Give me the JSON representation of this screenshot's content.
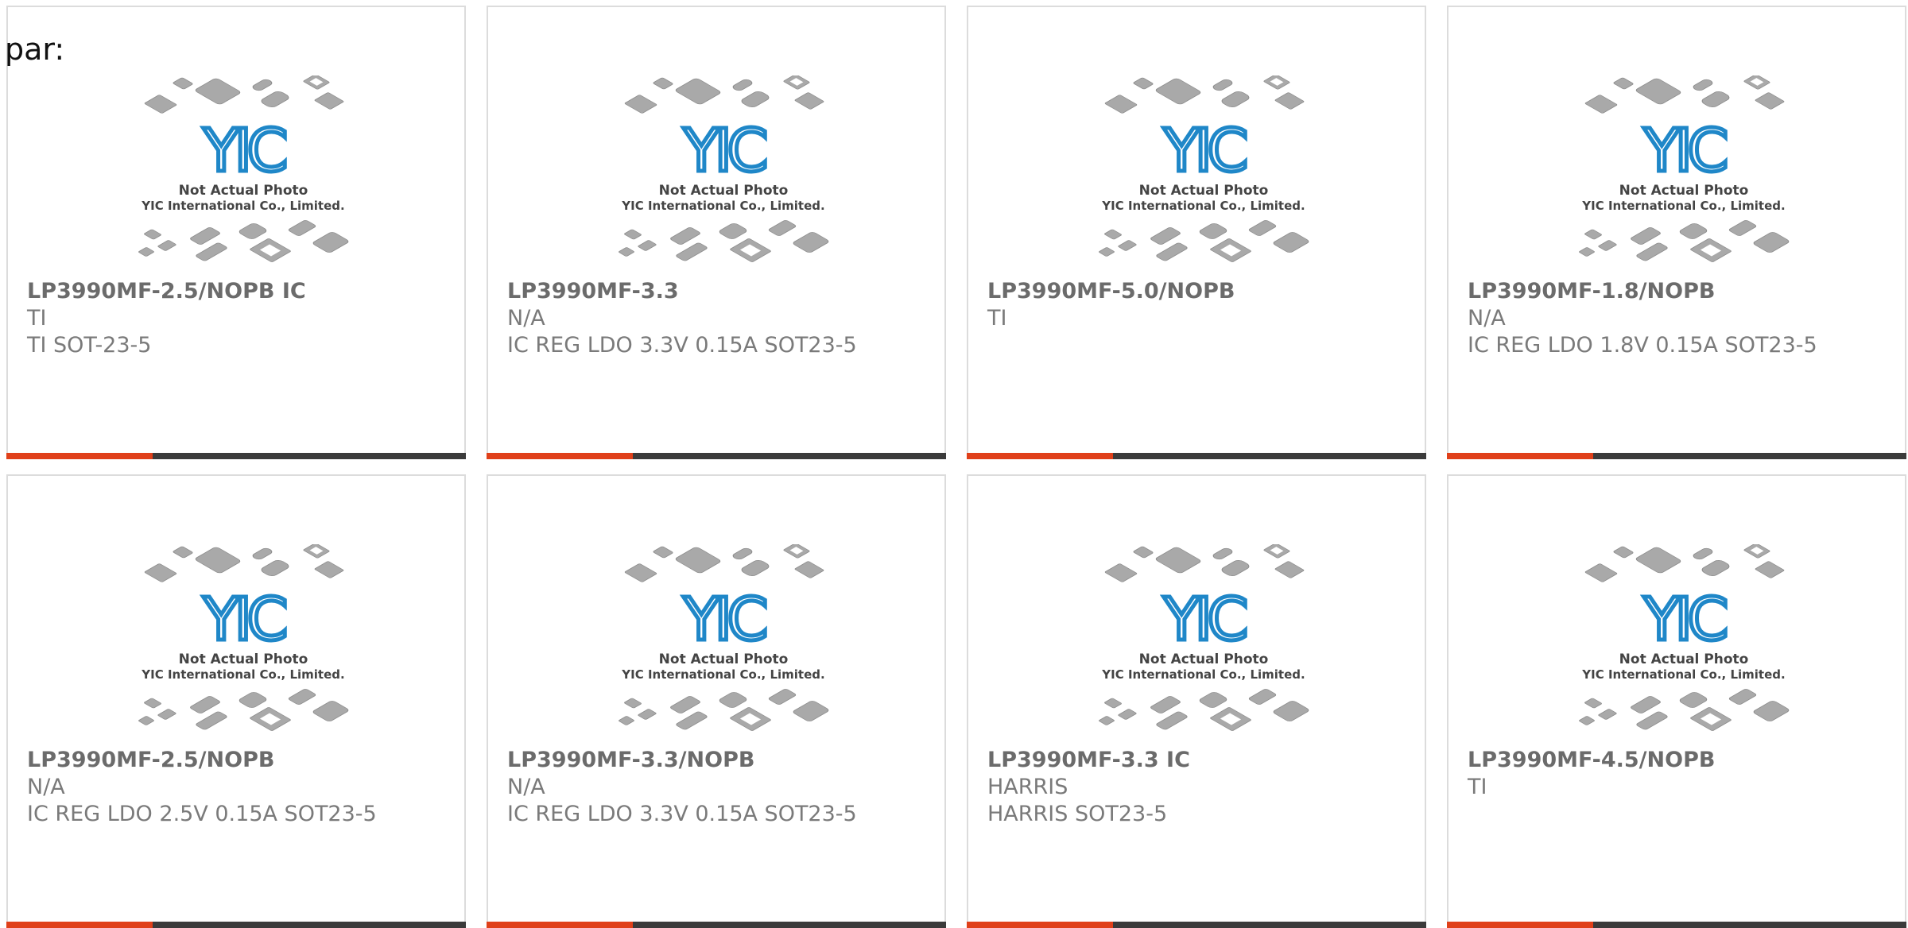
{
  "page": {
    "label": "par:"
  },
  "colors": {
    "accent": "#e0401a",
    "bar_rest": "#3b3b3b",
    "logo_blue": "#1f87c8",
    "chip_gray": "#a9a9a9"
  },
  "photo": {
    "line1": "Not Actual Photo",
    "line2": "YIC International Co., Limited.",
    "logo_text": "YIC"
  },
  "products": [
    {
      "part": "LP3990MF-2.5/NOPB IC",
      "manufacturer": "TI",
      "description": "TI SOT-23-5"
    },
    {
      "part": "LP3990MF-3.3",
      "manufacturer": "N/A",
      "description": "IC REG LDO 3.3V 0.15A SOT23-5"
    },
    {
      "part": "LP3990MF-5.0/NOPB",
      "manufacturer": "TI",
      "description": ""
    },
    {
      "part": "LP3990MF-1.8/NOPB",
      "manufacturer": "N/A",
      "description": "IC REG LDO 1.8V 0.15A SOT23-5"
    },
    {
      "part": "LP3990MF-2.5/NOPB",
      "manufacturer": "N/A",
      "description": "IC REG LDO 2.5V 0.15A SOT23-5"
    },
    {
      "part": "LP3990MF-3.3/NOPB",
      "manufacturer": "N/A",
      "description": "IC REG LDO 3.3V 0.15A SOT23-5"
    },
    {
      "part": "LP3990MF-3.3 IC",
      "manufacturer": "HARRIS",
      "description": "HARRIS SOT23-5"
    },
    {
      "part": "LP3990MF-4.5/NOPB",
      "manufacturer": "TI",
      "description": ""
    }
  ]
}
